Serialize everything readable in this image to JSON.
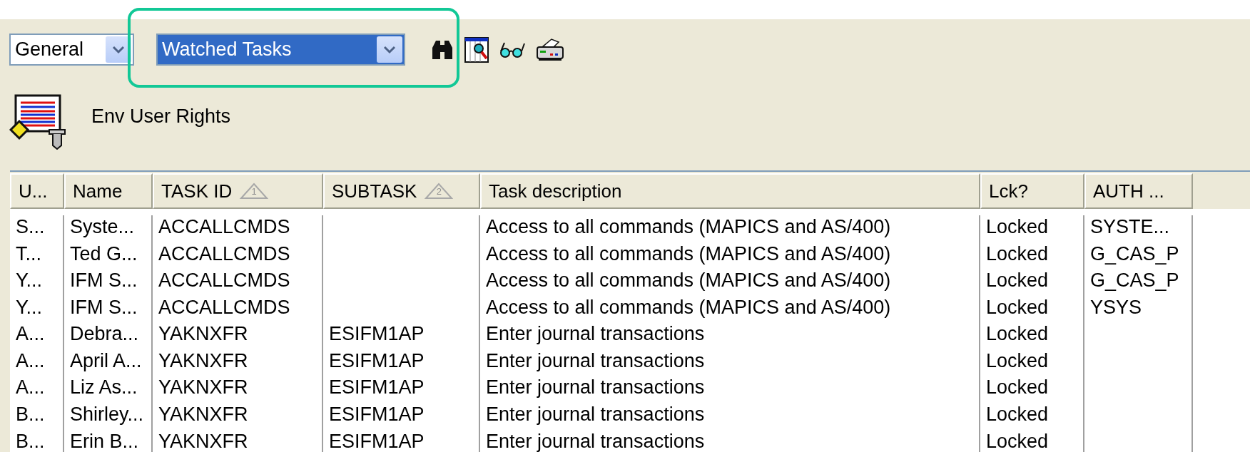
{
  "toolbar": {
    "combos": [
      {
        "value": "General",
        "focused": false,
        "highlighted": false
      },
      {
        "value": "Watched Tasks",
        "focused": true,
        "highlighted": true
      }
    ]
  },
  "heading": {
    "title": "Env User Rights"
  },
  "table": {
    "columns": [
      {
        "label": "U..."
      },
      {
        "label": "Name"
      },
      {
        "label": "TASK ID",
        "sort_order": "1"
      },
      {
        "label": "SUBTASK",
        "sort_order": "2"
      },
      {
        "label": "Task description"
      },
      {
        "label": "Lck?"
      },
      {
        "label": "AUTH ..."
      }
    ],
    "rows": [
      {
        "cells": [
          "S...",
          "Syste...",
          "ACCALLCMDS",
          null,
          "Access to all commands (MAPICS and AS/400)",
          "Locked",
          "SYSTE..."
        ]
      },
      {
        "cells": [
          "T...",
          "Ted G...",
          "ACCALLCMDS",
          null,
          "Access to all commands (MAPICS and AS/400)",
          "Locked",
          "G_CAS_P"
        ]
      },
      {
        "cells": [
          "Y...",
          "IFM S...",
          "ACCALLCMDS",
          null,
          "Access to all commands (MAPICS and AS/400)",
          "Locked",
          "G_CAS_P"
        ]
      },
      {
        "cells": [
          "Y...",
          "IFM S...",
          "ACCALLCMDS",
          null,
          "Access to all commands (MAPICS and AS/400)",
          "Locked",
          "YSYS"
        ]
      },
      {
        "cells": [
          "A...",
          "Debra...",
          "YAKNXFR",
          "ESIFM1AP",
          "Enter journal transactions",
          "Locked",
          null
        ]
      },
      {
        "cells": [
          "A...",
          "April A...",
          "YAKNXFR",
          "ESIFM1AP",
          "Enter journal transactions",
          "Locked",
          null
        ]
      },
      {
        "cells": [
          "A...",
          "Liz As...",
          "YAKNXFR",
          "ESIFM1AP",
          "Enter journal transactions",
          "Locked",
          null
        ]
      },
      {
        "cells": [
          "B...",
          "Shirley...",
          "YAKNXFR",
          "ESIFM1AP",
          "Enter journal transactions",
          "Locked",
          null
        ]
      },
      {
        "cells": [
          "B...",
          "Erin B...",
          "YAKNXFR",
          "ESIFM1AP",
          "Enter journal transactions",
          "Locked",
          null
        ]
      }
    ]
  }
}
